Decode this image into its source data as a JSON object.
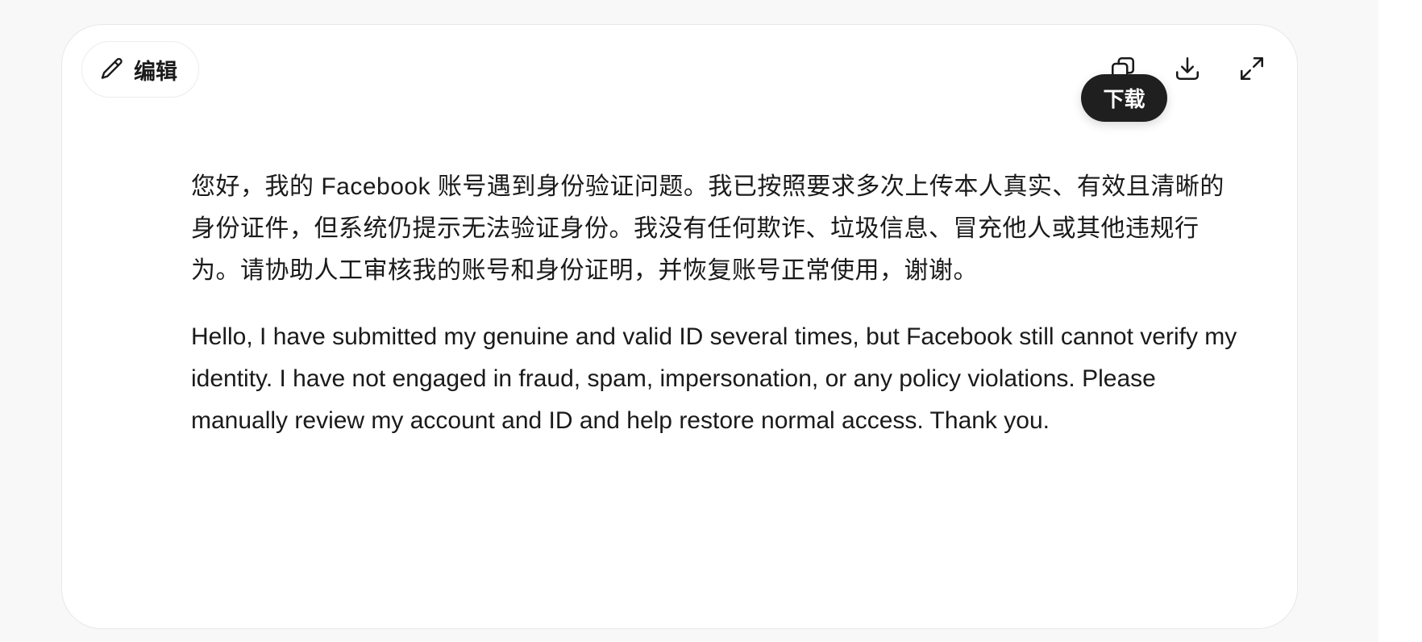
{
  "toolbar": {
    "edit_label": "编辑",
    "edit_icon": "pencil-icon",
    "copy_icon": "copy-icon",
    "download_icon": "download-icon",
    "expand_icon": "expand-icon",
    "tooltip": "下载"
  },
  "content": {
    "paragraph_zh": "您好，我的 Facebook 账号遇到身份验证问题。我已按照要求多次上传本人真实、有效且清晰的身份证件，但系统仍提示无法验证身份。我没有任何欺诈、垃圾信息、冒充他人或其他违规行为。请协助人工审核我的账号和身份证明，并恢复账号正常使用，谢谢。",
    "paragraph_en": "Hello, I have submitted my genuine and valid ID several times, but Facebook still cannot verify my identity. I have not engaged in fraud, spam, impersonation, or any policy violations. Please manually review my account and ID and help restore normal access. Thank you."
  },
  "colors": {
    "text": "#1a1a1a",
    "tooltip_bg": "#1f1f1f",
    "card_border": "#e8e8e8",
    "page_bg": "#f8f8f8"
  }
}
